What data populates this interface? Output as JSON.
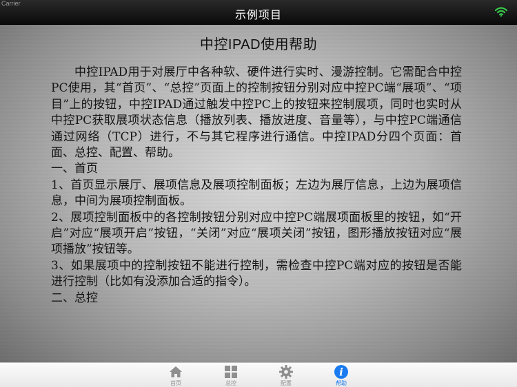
{
  "status_bar": {
    "carrier": "Carrier"
  },
  "nav": {
    "title": "示例项目"
  },
  "help": {
    "title": "中控IPAD使用帮助",
    "paragraphs": [
      "中控IPAD用于对展厅中各种软、硬件进行实时、漫游控制。它需配合中控PC使用，其“首页”、“总控”页面上的控制按钮分别对应中控PC端“展项”、“项目”上的按钮，中控IPAD通过触发中控PC上的按钮来控制展项，同时也实时从中控PC获取展项状态信息（播放列表、播放进度、音量等），与中控PC端通信通过网络（TCP）进行，不与其它程序进行通信。中控IPAD分四个页面：首面、总控、配置、帮助。",
      "一、首页",
      "1、首页显示展厅、展项信息及展项控制面板；左边为展厅信息，上边为展项信息，中间为展项控制面板。",
      "2、展项控制面板中的各控制按钮分别对应中控PC端展项面板里的按钮，如“开启”对应“展项开启”按钮，“关闭”对应“展项关闭”按钮，图形播放按钮对应“展项播放”按钮等。",
      "3、如果展项中的控制按钮不能进行控制，需检查中控PC端对应的按钮是否能进行控制（比如有没添加合适的指令）。",
      "二、总控"
    ]
  },
  "tabs": [
    {
      "label": "首页",
      "icon": "home-icon",
      "active": false
    },
    {
      "label": "总控",
      "icon": "grid-icon",
      "active": false
    },
    {
      "label": "配置",
      "icon": "gear-icon",
      "active": false
    },
    {
      "label": "帮助",
      "icon": "info-icon",
      "active": true
    }
  ],
  "colors": {
    "tab_active": "#1a7bf0",
    "tab_inactive": "#8e8e8e",
    "wifi": "#36c84a"
  }
}
